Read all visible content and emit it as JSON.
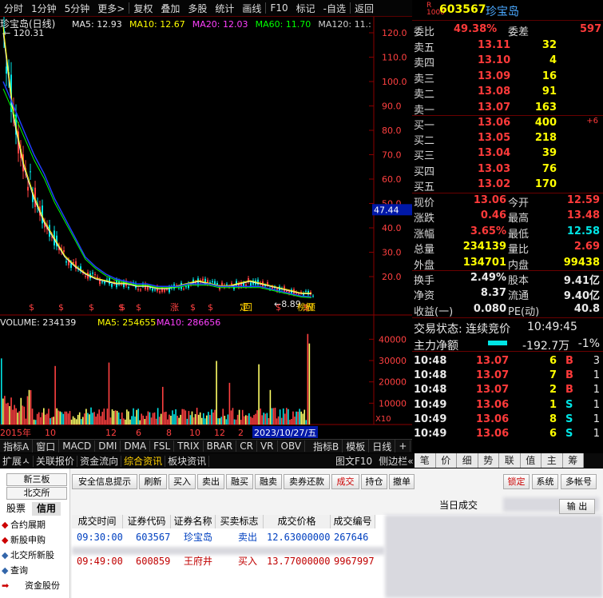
{
  "toolbar": {
    "items": [
      "分时",
      "1分钟",
      "5分钟",
      "更多>",
      "复权",
      "叠加",
      "多股",
      "统计",
      "画线",
      "F10",
      "标记",
      "-自选",
      "返回"
    ]
  },
  "chart": {
    "title": "珍宝岛(日线)",
    "ma": [
      {
        "label": "MA5: 12.93",
        "color": "#e8e8e8"
      },
      {
        "label": "MA10: 12.67",
        "color": "#ffff00"
      },
      {
        "label": "MA20: 12.03",
        "color": "#ff40ff"
      },
      {
        "label": "MA60: 11.70",
        "color": "#00ff00"
      },
      {
        "label": "MA120: 11.:",
        "color": "#d0d0d0"
      }
    ],
    "high_marker": "120.31",
    "low_marker": "8.89",
    "price_tag": "47.44",
    "yticks": [
      "120.0",
      "110.0",
      "100.0",
      "90.0",
      "80.0",
      "70.0",
      "60.0",
      "50.0",
      "40.0",
      "30.0",
      "20.0"
    ],
    "volume_label": "VOLUME: 234139",
    "vol_ma5": "MA5: 254655",
    "vol_ma10": "MA10: 286656",
    "vticks": [
      "40000",
      "30000",
      "20000",
      "10000"
    ],
    "vol_unit": "X10",
    "xticks": [
      "2015年",
      "10",
      "",
      "12",
      "6",
      "8",
      "10",
      "12",
      "2",
      "4"
    ],
    "cursor_date": "2023/10/27/五",
    "event_marks": [
      "$",
      "$",
      "$",
      "$",
      "$",
      "$",
      "涨",
      "$",
      "$",
      "定",
      "回",
      "$",
      "榜",
      "$",
      "权",
      "预"
    ]
  },
  "chart_data": {
    "type": "line",
    "title": "珍宝岛(日线)",
    "xlabel": "",
    "ylabel": "",
    "ylim": [
      0,
      125
    ],
    "series": [
      {
        "name": "MA5",
        "values": [
          120,
          85,
          65,
          52,
          42,
          35,
          28,
          24,
          21,
          19,
          18,
          17,
          17,
          16,
          16,
          15,
          15,
          16,
          17,
          18,
          17,
          16,
          16,
          17,
          18,
          17,
          16,
          15,
          14,
          13,
          12.93
        ]
      },
      {
        "name": "MA60",
        "values": [
          100,
          90,
          80,
          70,
          62,
          52,
          44,
          36,
          28,
          24,
          21,
          19,
          18,
          17,
          17,
          16,
          16,
          16,
          17,
          17,
          17,
          16,
          16,
          16,
          16,
          16,
          15,
          14,
          13,
          12,
          11.7
        ]
      }
    ]
  },
  "quote": {
    "code": "603567",
    "name": "珍宝岛",
    "webi": {
      "l1": "委比",
      "v1": "49.38%",
      "l2": "委差",
      "v2": "597"
    },
    "asks": [
      {
        "l": "卖五",
        "p": "13.11",
        "v": "32"
      },
      {
        "l": "卖四",
        "p": "13.10",
        "v": "4"
      },
      {
        "l": "卖三",
        "p": "13.09",
        "v": "16"
      },
      {
        "l": "卖二",
        "p": "13.08",
        "v": "91"
      },
      {
        "l": "卖一",
        "p": "13.07",
        "v": "163"
      }
    ],
    "bids": [
      {
        "l": "买一",
        "p": "13.06",
        "v": "400",
        "d": "+6"
      },
      {
        "l": "买二",
        "p": "13.05",
        "v": "218",
        "d": ""
      },
      {
        "l": "买三",
        "p": "13.04",
        "v": "39",
        "d": ""
      },
      {
        "l": "买四",
        "p": "13.03",
        "v": "76",
        "d": ""
      },
      {
        "l": "买五",
        "p": "13.02",
        "v": "170",
        "d": ""
      }
    ],
    "stats1": [
      {
        "l1": "现价",
        "v1": "13.06",
        "l2": "今开",
        "v2": "12.59"
      },
      {
        "l1": "涨跌",
        "v1": "0.46",
        "l2": "最高",
        "v2": "13.48"
      },
      {
        "l1": "涨幅",
        "v1": "3.65%",
        "l2": "最低",
        "v2": "12.58"
      },
      {
        "l1": "总量",
        "v1": "234139",
        "l2": "量比",
        "v2": "2.69"
      },
      {
        "l1": "外盘",
        "v1": "134701",
        "l2": "内盘",
        "v2": "99438"
      }
    ],
    "stats2": [
      {
        "l1": "换手",
        "v1": "2.49%",
        "l2": "股本",
        "v2": "9.41亿"
      },
      {
        "l1": "净资",
        "v1": "8.37",
        "l2": "流通",
        "v2": "9.40亿"
      },
      {
        "l1": "收益(一)",
        "v1": "0.080",
        "l2": "PE(动)",
        "v2": "40.8"
      }
    ],
    "status": "交易状态: 连续竞价",
    "time": "10:49:45",
    "mainflow_label": "主力净额",
    "mainflow_value": "-192.7万",
    "mainflow_pct": "-1%",
    "ticks": [
      {
        "t": "10:48",
        "p": "13.07",
        "v": "6",
        "s": "B",
        "n": "3"
      },
      {
        "t": "10:48",
        "p": "13.07",
        "v": "7",
        "s": "B",
        "n": "1"
      },
      {
        "t": "10:48",
        "p": "13.07",
        "v": "2",
        "s": "B",
        "n": "1"
      },
      {
        "t": "10:49",
        "p": "13.06",
        "v": "1",
        "s": "S",
        "n": "1"
      },
      {
        "t": "10:49",
        "p": "13.06",
        "v": "8",
        "s": "S",
        "n": "1"
      },
      {
        "t": "10:49",
        "p": "13.06",
        "v": "6",
        "s": "S",
        "n": "1"
      }
    ]
  },
  "indexbar": [
    "指标A",
    "窗口",
    "MACD",
    "DMI",
    "DMA",
    "FSL",
    "TRIX",
    "BRAR",
    "CR",
    "VR",
    "OBV",
    "指标B",
    "模板",
    "日线",
    "+",
    "-"
  ],
  "extbar": {
    "left": [
      "扩展ㅅ",
      "关联报价",
      "资金流向",
      "综合资讯",
      "板块资讯"
    ],
    "right": [
      "图文F10",
      "侧边栏«"
    ],
    "tabs": [
      "笔",
      "价",
      "细",
      "势",
      "联",
      "值",
      "主",
      "筹"
    ]
  },
  "trade": {
    "nav_tabs": [
      "新三板",
      "北交所"
    ],
    "sub_tabs": [
      "股票",
      "信用"
    ],
    "nav_items": [
      "合约展期",
      "新股申购",
      "北交所新股",
      "查询",
      "资金股份"
    ],
    "buttons": [
      "安全信息提示",
      "刷新",
      "买入",
      "卖出",
      "融买",
      "融卖",
      "卖券还款",
      "成交",
      "持仓",
      "撤单"
    ],
    "title": "当日成交",
    "right_buttons": [
      "锁定",
      "系统",
      "多帐号"
    ],
    "output_btn": "输 出",
    "headers": [
      "成交时间",
      "证券代码",
      "证券名称",
      "买卖标志",
      "成交价格",
      "成交编号"
    ],
    "rows": [
      {
        "time": "09:30:00",
        "code": "603567",
        "name": "珍宝岛",
        "side": "卖出",
        "price": "12.63000000",
        "id": "267646"
      },
      {
        "time": "09:49:00",
        "code": "600859",
        "name": "王府井",
        "side": "买入",
        "price": "13.77000000",
        "id": "9967997"
      }
    ]
  }
}
